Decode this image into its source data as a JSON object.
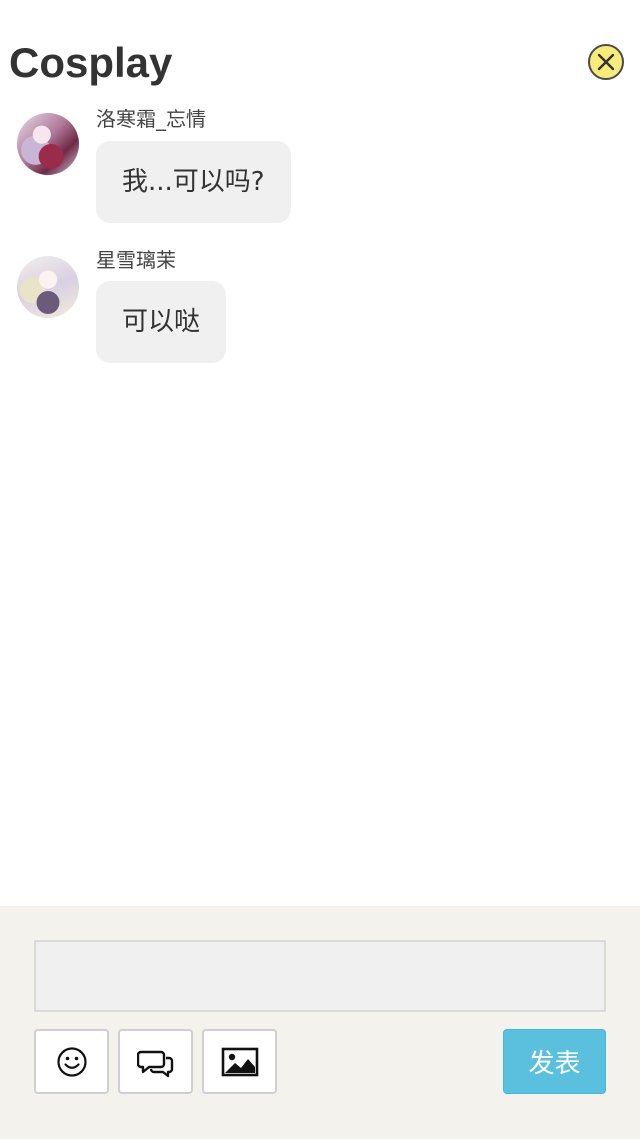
{
  "header": {
    "title": "Cosplay",
    "close_icon": "close-circle-icon",
    "close_color": "#f7ec7a"
  },
  "messages": [
    {
      "username": "洛寒霜_忘情",
      "text": "我...可以吗?",
      "avatar": "avatar-anime-girl-red"
    },
    {
      "username": "星雪璃茉",
      "text": "可以哒",
      "avatar": "avatar-anime-girl-white"
    }
  ],
  "composer": {
    "input_value": "",
    "input_placeholder": "",
    "tools": [
      "smiley-icon",
      "chat-bubbles-icon",
      "image-icon"
    ],
    "send_label": "发表",
    "send_color": "#5bc0de"
  },
  "colors": {
    "bubble": "#f0f0f0",
    "composer_bg": "#f3f2ed"
  }
}
